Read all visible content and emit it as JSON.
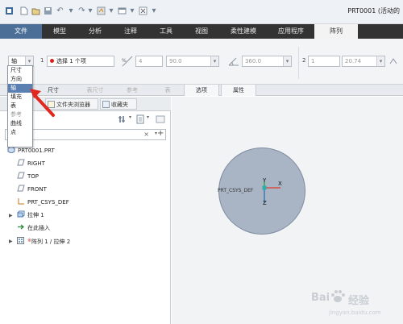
{
  "titlebar": {
    "title": "PRT0001 (活动的",
    "quick_access_icons": [
      "new-icon",
      "open-icon",
      "save-icon",
      "undo-icon",
      "redo-icon",
      "regenerate-icon",
      "windows-icon",
      "close-icon",
      "customize-icon"
    ]
  },
  "ribbon_tabs": [
    "文件",
    "模型",
    "分析",
    "注释",
    "工具",
    "视图",
    "柔性建模",
    "应用程序",
    "阵列"
  ],
  "active_tab": "阵列",
  "ribbon": {
    "type_select": "轴",
    "first_direction_num": "1",
    "selection_text": "选择 1 个项",
    "member_count": "4",
    "angle_increment": "90.0",
    "angle_range": "360.0",
    "second_direction_num": "2",
    "second_count": "1",
    "second_increment": "20.74"
  },
  "type_dropdown": {
    "options": [
      "尺寸",
      "方向",
      "轴",
      "填充",
      "表",
      "参考",
      "曲线",
      "点"
    ],
    "selected": "轴"
  },
  "panels": [
    "尺寸",
    "表尺寸",
    "参考",
    "表",
    "选项",
    "属性"
  ],
  "navigator": {
    "tabs": [
      "文件夹浏览器",
      "收藏夹"
    ],
    "truncated_label": "f"
  },
  "model_tree": [
    {
      "label": "PRT0001.PRT",
      "icon": "part-icon"
    },
    {
      "label": "RIGHT",
      "icon": "datum-plane-icon"
    },
    {
      "label": "TOP",
      "icon": "datum-plane-icon"
    },
    {
      "label": "FRONT",
      "icon": "datum-plane-icon"
    },
    {
      "label": "PRT_CSYS_DEF",
      "icon": "csys-icon"
    },
    {
      "label": "拉伸 1",
      "icon": "extrude-icon"
    },
    {
      "label": "在此插入",
      "icon": "insert-here-icon"
    },
    {
      "label": "阵列 1 / 拉伸 2",
      "icon": "pattern-icon"
    }
  ],
  "graphics": {
    "csys_label": "PRT_CSYS_DEF",
    "axis_x": "X",
    "axis_y": "Y",
    "axis_z": "Z"
  },
  "watermark": {
    "brand": "Bai",
    "brand2": "经验",
    "url": "jingyan.baidu.com"
  },
  "colors": {
    "accent": "#4b6f96",
    "part_fill": "#a9b4c4",
    "annotation_arrow": "#e0281e",
    "selected_item": "#5a7fb0"
  }
}
